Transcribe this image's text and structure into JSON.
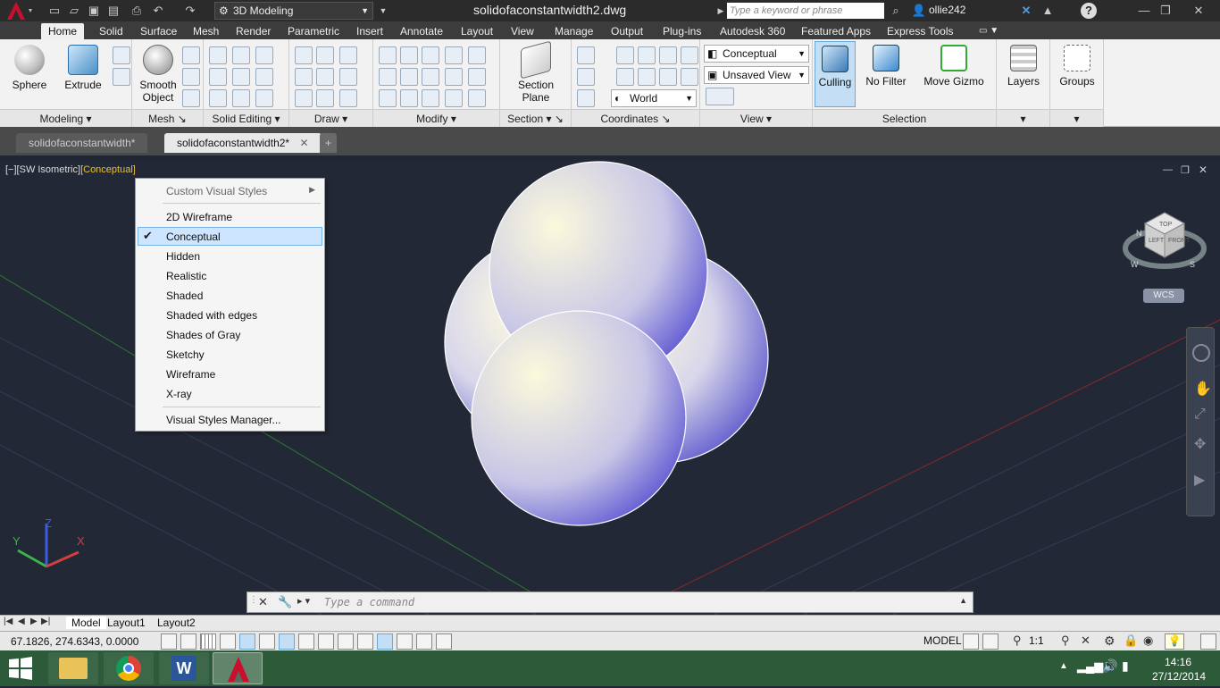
{
  "titlebar": {
    "workspace": "3D Modeling",
    "document_title": "solidofaconstantwidth2.dwg",
    "search_placeholder": "Type a keyword or phrase",
    "user": "ollie242"
  },
  "ribbon_tabs": [
    "Home",
    "Solid",
    "Surface",
    "Mesh",
    "Render",
    "Parametric",
    "Insert",
    "Annotate",
    "Layout",
    "View",
    "Manage",
    "Output",
    "Plug-ins",
    "Autodesk 360",
    "Featured Apps",
    "Express Tools"
  ],
  "ribbon": {
    "modeling": {
      "title": "Modeling",
      "sphere": "Sphere",
      "extrude": "Extrude"
    },
    "mesh": {
      "title": "Mesh",
      "smooth_object_1": "Smooth",
      "smooth_object_2": "Object"
    },
    "solid_editing": {
      "title": "Solid Editing"
    },
    "draw": {
      "title": "Draw"
    },
    "modify": {
      "title": "Modify"
    },
    "section": {
      "title": "Section",
      "section_plane_1": "Section",
      "section_plane_2": "Plane"
    },
    "coordinates": {
      "title": "Coordinates",
      "ucs_value": "World"
    },
    "view": {
      "title": "View",
      "visual_style": "Conceptual",
      "named_view": "Unsaved View"
    },
    "selection": {
      "title": "Selection",
      "culling": "Culling",
      "no_filter": "No Filter",
      "move_gizmo": "Move Gizmo"
    },
    "layers": {
      "label": "Layers"
    },
    "groups": {
      "label": "Groups"
    }
  },
  "doc_tabs": [
    "solidofaconstantwidth*",
    "solidofaconstantwidth2*"
  ],
  "viewport": {
    "label_minus": "[−]",
    "label_view": "[SW Isometric]",
    "label_style": "[Conceptual]",
    "wcs": "WCS",
    "cube_top": "TOP",
    "cube_left": "LEFT",
    "cube_front": "FRONT",
    "compass_n": "N",
    "compass_w": "W",
    "compass_s": "S",
    "axis_x": "X",
    "axis_y": "Y",
    "axis_z": "Z"
  },
  "visual_styles_menu": {
    "custom": "Custom Visual Styles",
    "items": [
      "2D Wireframe",
      "Conceptual",
      "Hidden",
      "Realistic",
      "Shaded",
      "Shaded with edges",
      "Shades of Gray",
      "Sketchy",
      "Wireframe",
      "X-ray"
    ],
    "selected": "Conceptual",
    "manager": "Visual Styles Manager..."
  },
  "command_line": {
    "placeholder": "Type a command"
  },
  "layout_tabs": [
    "Model",
    "Layout1",
    "Layout2"
  ],
  "statusbar": {
    "coords": "67.1826, 274.6343, 0.0000",
    "space": "MODEL",
    "scale": "1:1"
  },
  "taskbar": {
    "time": "14:16",
    "date": "27/12/2014"
  },
  "colors": {
    "accent": "#3399ff",
    "selection_bg": "#cde5ff",
    "sphere_light": "#fdfbe0",
    "sphere_dark": "#4a46c8"
  }
}
